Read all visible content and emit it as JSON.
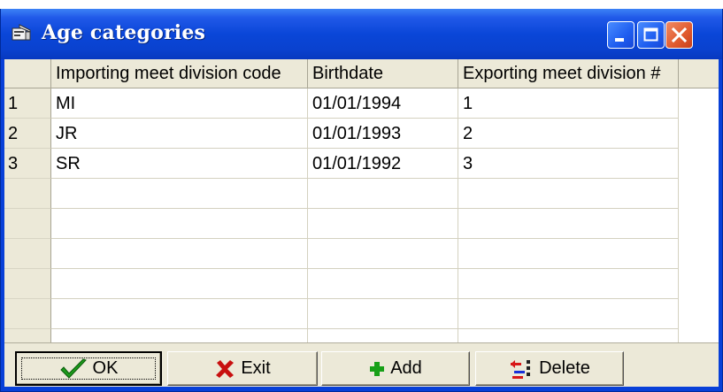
{
  "document_fragment": {
    "text_before": "",
    "link_text": ""
  },
  "window": {
    "title": "Age categories",
    "minimize_glyph": "_",
    "maximize_glyph": "□",
    "close_glyph": "✕"
  },
  "grid": {
    "headers": [
      "",
      "Importing meet division code",
      "Birthdate",
      "Exporting meet division #"
    ],
    "rows": [
      {
        "num": "1",
        "code": "MI",
        "birthdate": "01/01/1994",
        "division": "1"
      },
      {
        "num": "2",
        "code": "JR",
        "birthdate": "01/01/1993",
        "division": "2"
      },
      {
        "num": "3",
        "code": "SR",
        "birthdate": "01/01/1992",
        "division": "3"
      }
    ]
  },
  "buttons": {
    "ok": "OK",
    "exit": "Exit",
    "add": "Add",
    "delete": "Delete"
  },
  "colors": {
    "title_bar": "#0a46d8",
    "ok_check": "#1c9a1c",
    "exit_x": "#c81010",
    "add_plus": "#18a018",
    "delete_red": "#d81818",
    "delete_blue": "#1830d8"
  }
}
